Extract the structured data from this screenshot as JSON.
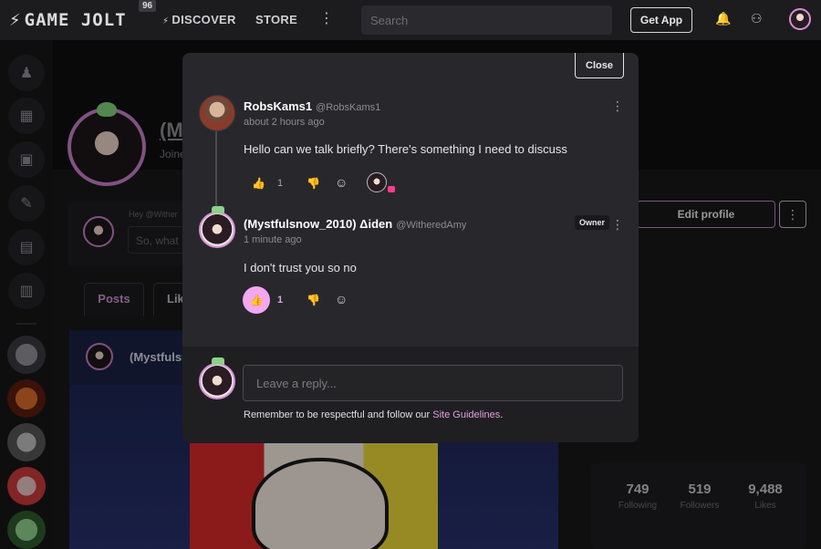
{
  "topbar": {
    "logo_text": "GAME JOLT",
    "badge_count": "96",
    "discover_label": "DISCOVER",
    "store_label": "STORE",
    "more_glyph": "⋮",
    "search_placeholder": "Search",
    "get_app_label": "Get App"
  },
  "background": {
    "profile_name": "(M",
    "joined_text": "Joine",
    "compose_hey": "Hey @Wither",
    "compose_placeholder": "So, what",
    "tab_posts": "Posts",
    "tab_likes": "Lik",
    "post_author": "(Mystfulsn",
    "edit_profile_label": "Edit profile",
    "stats": [
      {
        "value": "749",
        "label": "Following"
      },
      {
        "value": "519",
        "label": "Followers"
      },
      {
        "value": "9,488",
        "label": "Likes"
      }
    ]
  },
  "modal": {
    "close_label": "Close",
    "comments": [
      {
        "author": "RobsKams1",
        "handle": "@RobsKams1",
        "time": "about 2 hours ago",
        "text": "Hello can we talk briefly? There's something I need to discuss",
        "likes": "1"
      },
      {
        "author": "(Mystfulsnow_2010) Δiden",
        "handle": "@WitheredAmy",
        "badge": "Owner",
        "time": "1 minute ago",
        "text": "I don't trust you so no",
        "likes": "1"
      }
    ],
    "reply": {
      "placeholder": "Leave a reply...",
      "notice_prefix": "Remember to be respectful and follow our ",
      "notice_link": "Site Guidelines",
      "notice_suffix": "."
    }
  },
  "colors": {
    "accent": "#e39ee0",
    "like_active_bg": "#f3a7f0",
    "modal_bg": "#28282c"
  }
}
